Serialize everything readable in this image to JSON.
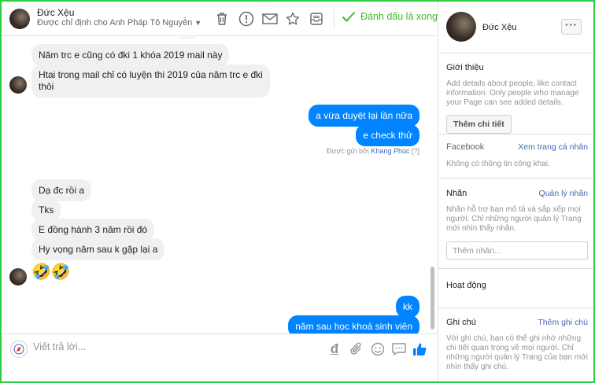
{
  "header": {
    "name": "Đức Xệu",
    "assigned_to": "Được chỉ định cho Anh Pháp Tô Nguyễn",
    "mark_done": "Đánh dấu là xong",
    "icons": [
      "trash-icon",
      "spam-icon",
      "envelope-icon",
      "star-icon",
      "archive-icon",
      "check-icon"
    ]
  },
  "messages": {
    "incoming_top": [
      "Năm trc e cũng có đki 1 khóa 2019 mail này",
      "Htai trong mail chỉ có luyện thi 2019 của năm trc e đki\nthôi"
    ],
    "outgoing_1": [
      "a vừa duyệt lại lần nữa",
      "e check thử"
    ],
    "sent_by_prefix": "Được gửi bởi",
    "sent_by_name": "Khang Phúc",
    "sent_by_help": "[?]",
    "incoming_mid": [
      "Dạ đc rồi a",
      "Tks",
      "E đồng hành 3 năm rồi đó",
      "Hy vọng năm sau k gặp lại a"
    ],
    "emoji": "🤣🤣",
    "outgoing_2": [
      "kk",
      "năm sau học khoá sinh viên"
    ]
  },
  "composer": {
    "placeholder": "Viết trả lời...",
    "currency_symbol": "đ",
    "icons": [
      "dong-icon",
      "attachment-icon",
      "emoji-icon",
      "saved-reply-icon",
      "like-icon"
    ]
  },
  "sidebar": {
    "name": "Đức Xệu",
    "more": "···",
    "intro_title": "Giới thiệu",
    "intro_text": "Add details about people, like contact information. Only people who manage your Page can see added details.",
    "add_details_button": "Thêm chi tiết",
    "facebook_label": "Facebook",
    "view_all_link": "Xem trang cá nhân",
    "no_public_info": "Không có thông tin công khai.",
    "labels_title": "Nhãn",
    "manage_labels_link": "Quản lý nhãn",
    "labels_text": "Nhãn hỗ trợ bạn mô tả và sắp xếp mọi người. Chỉ những người quản lý Trang mới nhìn thấy nhãn.",
    "add_label_placeholder": "Thêm nhãn...",
    "activity_title": "Hoạt động",
    "notes_title": "Ghi chú",
    "add_note_link": "Thêm ghi chú",
    "notes_text": "Với ghi chú, bạn có thể ghi nhớ những chi tiết quan trọng về mọi người. Chỉ những người quản lý Trang của bạn mới nhìn thấy ghi chú."
  },
  "colors": {
    "accent_blue": "#0084ff",
    "done_green": "#42b72a",
    "link_blue": "#4267b2",
    "frame_green": "#2ecc40"
  }
}
